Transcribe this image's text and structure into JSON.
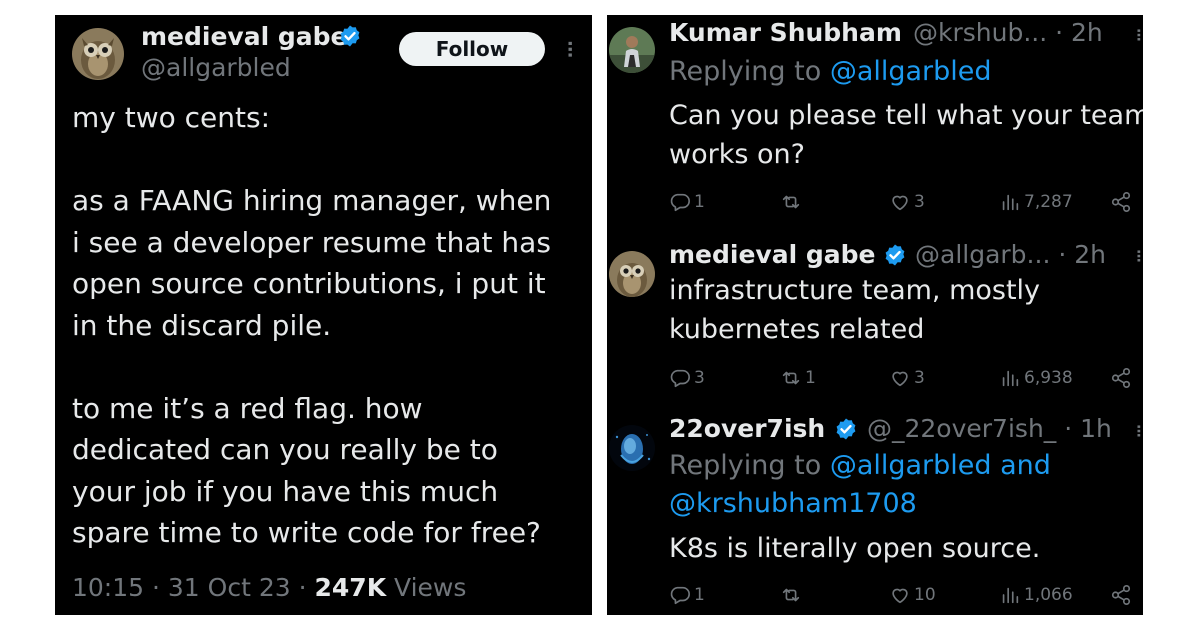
{
  "colors": {
    "background": "#000000",
    "text": "#e7e9ea",
    "muted": "#71767b",
    "link": "#1d9bf0",
    "verified": "#1d9bf0",
    "page_bg": "#ffffff"
  },
  "main_tweet": {
    "author_name": "medieval gabe",
    "author_handle": "@allgarbled",
    "follow_label": "Follow",
    "lines": [
      "my two cents:",
      "",
      "as a FAANG hiring manager, when",
      "i see a developer resume that has",
      "open source contributions, i put it",
      "in the discard pile.",
      "",
      "to me it’s a red flag. how",
      "dedicated can you really be to",
      "your job if you have this much",
      "spare time to write code for free?"
    ],
    "time": "10:15",
    "date": "31 Oct 23",
    "views_count": "247K",
    "views_label": "Views",
    "separator": "·"
  },
  "replies": [
    {
      "name": "Kumar Shubham",
      "handle_time": "@krshub... · 2h",
      "replying_prefix": "Replying to",
      "replying_to": "@allgarbled",
      "lines": [
        "Can you please tell what your team",
        "works on?"
      ],
      "reply_count": "1",
      "retweet_count": "",
      "like_count": "3",
      "views": "7,287"
    },
    {
      "name": "medieval gabe",
      "handle_time": "@allgarb... · 2h",
      "lines": [
        "infrastructure team, mostly",
        "kubernetes related"
      ],
      "reply_count": "3",
      "retweet_count": "1",
      "like_count": "3",
      "views": "6,938"
    },
    {
      "name": "22over7ish",
      "handle_time": "@_22over7ish_ · 1h",
      "replying_prefix": "Replying to",
      "replying_to_1": "@allgarbled and",
      "replying_to_2": "@krshubham1708",
      "lines": [
        "K8s is literally open source."
      ],
      "reply_count": "1",
      "retweet_count": "",
      "like_count": "10",
      "views": "1,066"
    }
  ]
}
